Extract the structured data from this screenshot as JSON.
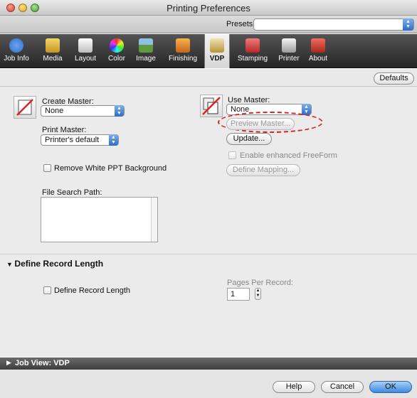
{
  "window": {
    "title": "Printing Preferences"
  },
  "presets": {
    "label": "Presets:",
    "value": ""
  },
  "toolbar": {
    "items": [
      {
        "label": "Job Info",
        "icon": "info-icon",
        "color": "#3f7fd1"
      },
      {
        "label": "Media",
        "icon": "media-icon",
        "color": "#e0b82b"
      },
      {
        "label": "Layout",
        "icon": "layout-icon",
        "color": "#dcdcdc"
      },
      {
        "label": "Color",
        "icon": "color-wheel-icon",
        "color": "#c744c4"
      },
      {
        "label": "Image",
        "icon": "image-icon",
        "color": "#6b9a46"
      },
      {
        "label": "Finishing",
        "icon": "finishing-icon",
        "color": "#e0a02b"
      },
      {
        "label": "VDP",
        "icon": "vdp-icon",
        "color": "#c7a34a"
      },
      {
        "label": "Stamping",
        "icon": "stamp-icon",
        "color": "#d84a4a"
      },
      {
        "label": "Printer",
        "icon": "printer-icon",
        "color": "#d8d8d8"
      },
      {
        "label": "About",
        "icon": "about-icon",
        "color": "#c9402f"
      }
    ],
    "active": "VDP"
  },
  "defaults_button": "Defaults",
  "vdp": {
    "create_master_label": "Create Master:",
    "create_master_value": "None",
    "print_master_label": "Print Master:",
    "print_master_value": "Printer's default",
    "remove_white_bg_label": "Remove White PPT Background",
    "file_search_path_label": "File Search Path:",
    "use_master_label": "Use Master:",
    "use_master_value": "None",
    "preview_master_button": "Preview Master...",
    "update_button": "Update...",
    "enable_freeform_label": "Enable enhanced FreeForm",
    "define_mapping_button": "Define Mapping..."
  },
  "record_section": {
    "title": "Define Record Length",
    "checkbox_label": "Define Record Length",
    "pages_per_record_label": "Pages Per Record:",
    "pages_per_record_value": "1"
  },
  "job_view": {
    "label": "Job View: VDP"
  },
  "footer": {
    "help": "Help",
    "cancel": "Cancel",
    "ok": "OK"
  }
}
